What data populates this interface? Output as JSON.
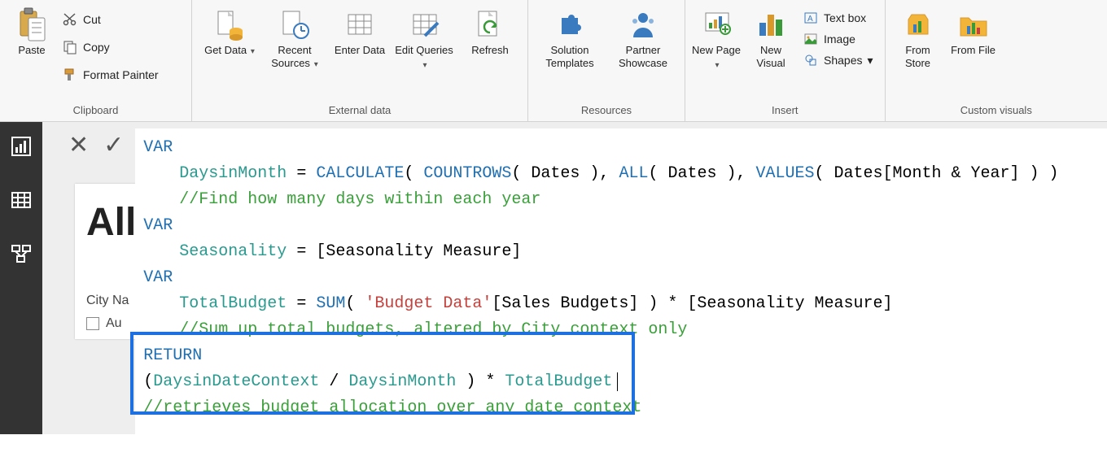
{
  "ribbon": {
    "clipboard": {
      "title": "Clipboard",
      "paste": "Paste",
      "cut": "Cut",
      "copy": "Copy",
      "format_painter": "Format Painter"
    },
    "external": {
      "title": "External data",
      "get_data": "Get Data",
      "recent_sources": "Recent Sources",
      "enter_data": "Enter Data",
      "edit_queries": "Edit Queries",
      "refresh": "Refresh"
    },
    "resources": {
      "title": "Resources",
      "solution_templates": "Solution Templates",
      "partner_showcase": "Partner Showcase"
    },
    "insert": {
      "title": "Insert",
      "new_page": "New Page",
      "new_visual": "New Visual",
      "text_box": "Text box",
      "image": "Image",
      "shapes": "Shapes"
    },
    "custom": {
      "title": "Custom visuals",
      "from_store": "From Store",
      "from_file": "From File"
    }
  },
  "card": {
    "title": "Allo",
    "label": "City Na",
    "opt1": "Au"
  },
  "code": {
    "l1_kw": "VAR",
    "l2_id": "DaysinMonth",
    "l2_eq": " = ",
    "l2_fn1": "CALCULATE",
    "l2_p1": "( ",
    "l2_fn2": "COUNTROWS",
    "l2_arg1": "( Dates ), ",
    "l2_fn3": "ALL",
    "l2_arg2": "( Dates ), ",
    "l2_fn4": "VALUES",
    "l2_arg3": "( Dates[Month & Year] ) )",
    "l3_cm": "//Find how many days within each year",
    "l4_kw": "VAR",
    "l5_id": "Seasonality",
    "l5_rest": " = [Seasonality Measure]",
    "l6_kw": "VAR",
    "l7_id": "TotalBudget",
    "l7_eq": " = ",
    "l7_fn": "SUM",
    "l7_p": "( ",
    "l7_str": "'Budget Data'",
    "l7_rest": "[Sales Budgets] ) * [Seasonality Measure]",
    "l8_cm": "//Sum up total budgets, altered by City context only",
    "l9_kw": "RETURN",
    "l10_a": "(",
    "l10_id1": "DaysinDateContext",
    "l10_b": " / ",
    "l10_id2": "DaysinMonth",
    "l10_c": " ) * ",
    "l10_id3": "TotalBudget",
    "l11_cm": "//retrieves budget allocation over any date context"
  }
}
